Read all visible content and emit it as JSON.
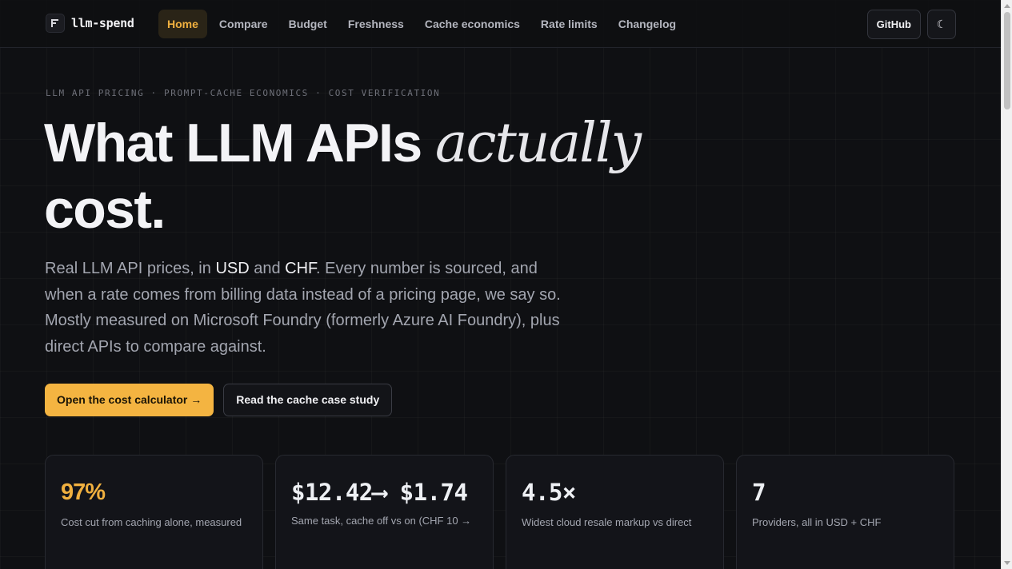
{
  "nav": {
    "brand": "llm-spend",
    "links": [
      "Home",
      "Compare",
      "Budget",
      "Freshness",
      "Cache economics",
      "Rate limits",
      "Changelog"
    ],
    "github": "GitHub",
    "theme_glyph": "☾"
  },
  "hero": {
    "eyebrow": "LLM API PRICING · PROMPT-CACHE ECONOMICS · COST VERIFICATION",
    "title_a": "What LLM APIs ",
    "title_em": "actually",
    "title_b": " cost.",
    "lede_1": "Real LLM API prices, in ",
    "lede_usd": "USD",
    "lede_2": " and ",
    "lede_chf": "CHF",
    "lede_3": ". Every number is sourced, and when a rate comes from billing data instead of a pricing page, we say so. Mostly measured on Microsoft Foundry (formerly Azure AI Foundry), plus direct APIs to compare against.",
    "cta_primary": "Open the cost calculator →",
    "cta_secondary": "Read the cache case study"
  },
  "stats": [
    {
      "value": "97%",
      "label": "Cost cut from caching alone, measured"
    },
    {
      "value": "$12.42⟶ $1.74",
      "label": "Same task, cache off vs on (CHF 10 →"
    },
    {
      "value": "4.5×",
      "label": "Widest cloud resale markup vs direct"
    },
    {
      "value": "7",
      "label": "Providers, all in USD + CHF"
    }
  ],
  "colors": {
    "accent": "#f4b441",
    "background": "#0f1013"
  }
}
